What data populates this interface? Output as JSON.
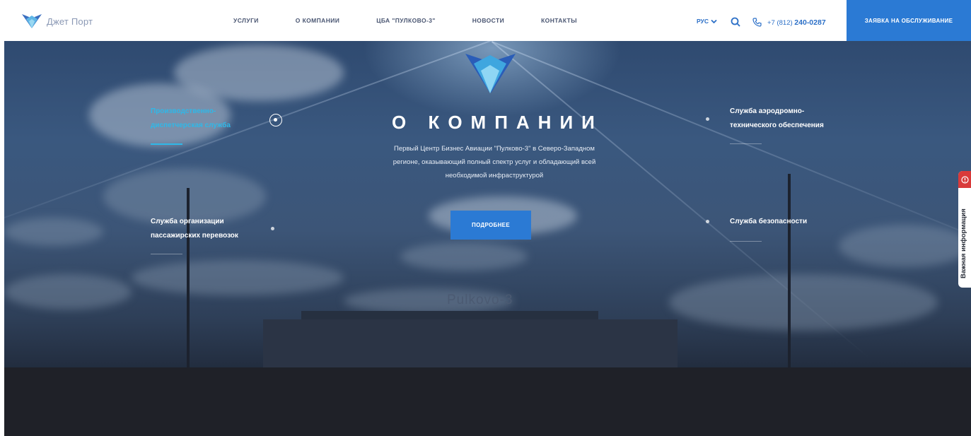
{
  "header": {
    "logo_text": "Джет Порт",
    "nav": [
      "УСЛУГИ",
      "О КОМПАНИИ",
      "ЦБА \"ПУЛКОВО-3\"",
      "НОВОСТИ",
      "КОНТАКТЫ"
    ],
    "language": "РУС",
    "phone_prefix": "+7 (812)",
    "phone_number": "240-0287",
    "cta_label": "ЗАЯВКА НА ОБСЛУЖИВАНИЕ"
  },
  "hero": {
    "title": "О КОМПАНИИ",
    "description": "Первый Центр Бизнес Авиации \"Пулково-3\" в Северо-Западном регионе, оказывающий полный спектр услуг и обладающий всей необходимой инфраструктурой",
    "more_label": "ПОДРОБНЕЕ",
    "background_sign": "Pulkovo-3",
    "services": [
      {
        "line1": "Производственно-",
        "line2": "диспетчерская служба",
        "active": true
      },
      {
        "line1": "Служба организации",
        "line2": "пассажирских перевозок",
        "active": false
      },
      {
        "line1": "Служба аэродромно-",
        "line2": "технического обеспечения",
        "active": false
      },
      {
        "line1": "Служба безопасности",
        "line2": "",
        "active": false
      }
    ]
  },
  "side_tab": {
    "label": "Важная информация"
  },
  "colors": {
    "accent": "#2b7ad4",
    "active_service": "#2fb8e8",
    "alert": "#d93a3a",
    "nav_text": "#4a5672"
  }
}
